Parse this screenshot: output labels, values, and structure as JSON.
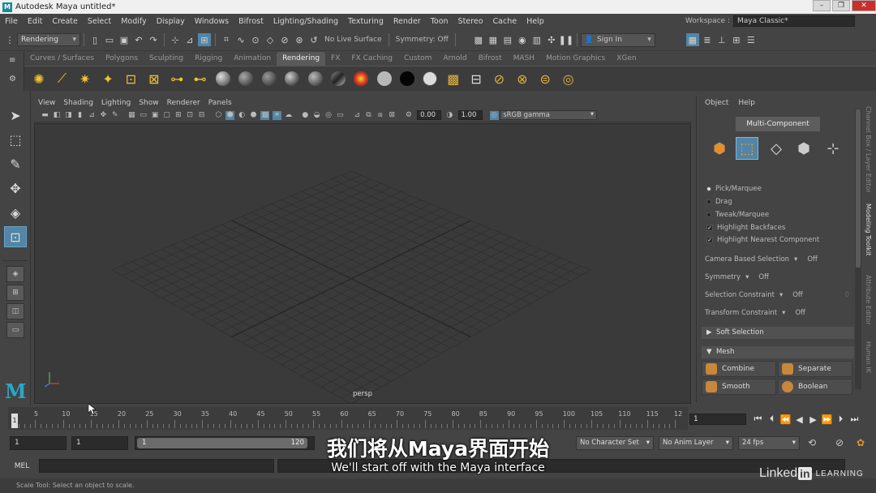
{
  "window": {
    "title": "Autodesk Maya  untitled*",
    "logo_letter": "M",
    "controls": {
      "minimize": "–",
      "restore": "❐",
      "close": "✕"
    }
  },
  "menubar": {
    "items": [
      "File",
      "Edit",
      "Create",
      "Select",
      "Modify",
      "Display",
      "Windows",
      "Bifrost",
      "Lighting/Shading",
      "Texturing",
      "Render",
      "Toon",
      "Stereo",
      "Cache",
      "Help"
    ],
    "workspace_label": "Workspace :",
    "workspace_value": "Maya Classic*"
  },
  "statusline": {
    "menuset": "Rendering",
    "live_surface": "No Live Surface",
    "symmetry": "Symmetry: Off",
    "sign_in": "Sign In"
  },
  "shelf": {
    "tabs": [
      "Curves / Surfaces",
      "Polygons",
      "Sculpting",
      "Rigging",
      "Animation",
      "Rendering",
      "FX",
      "FX Caching",
      "Custom",
      "Arnold",
      "Bifrost",
      "MASH",
      "Motion Graphics",
      "XGen"
    ],
    "active_tab": "Rendering"
  },
  "viewport": {
    "menu": [
      "View",
      "Shading",
      "Lighting",
      "Show",
      "Renderer",
      "Panels"
    ],
    "exposure": "0.00",
    "gamma_value": "1.00",
    "color_space": "sRGB gamma",
    "camera_label": "persp"
  },
  "modeling_toolkit": {
    "menu": [
      "Object",
      "Help"
    ],
    "multi_component": "Multi-Component",
    "selection_modes": {
      "pick": "Pick/Marquee",
      "drag": "Drag",
      "tweak": "Tweak/Marquee"
    },
    "checks": {
      "backfaces": "Highlight Backfaces",
      "nearest": "Highlight Nearest Component"
    },
    "settings": {
      "camera_based": {
        "label": "Camera Based Selection",
        "value": "Off"
      },
      "symmetry": {
        "label": "Symmetry",
        "value": "Off"
      },
      "sel_constraint": {
        "label": "Selection Constraint",
        "value": "Off",
        "extra": "0"
      },
      "transform_constraint": {
        "label": "Transform Constraint",
        "value": "Off"
      }
    },
    "sections": {
      "soft": "Soft Selection",
      "mesh": "Mesh"
    },
    "mesh_buttons": {
      "combine": "Combine",
      "separate": "Separate",
      "smooth": "Smooth",
      "boolean": "Boolean"
    }
  },
  "side_tabs": [
    "Channel Box / Layer Editor",
    "Modeling Toolkit",
    "Attribute Editor",
    "Human IK"
  ],
  "timeslider": {
    "ticks": [
      "5",
      "10",
      "15",
      "20",
      "25",
      "30",
      "35",
      "40",
      "45",
      "50",
      "55",
      "60",
      "65",
      "70",
      "75",
      "80",
      "85",
      "90",
      "95",
      "100",
      "105",
      "110",
      "115",
      "12"
    ],
    "current_frame": "1",
    "current_field": "1"
  },
  "rangebar": {
    "start": "1",
    "playback_start": "1",
    "range_start": "1",
    "range_end": "120",
    "character_set": "No Character Set",
    "anim_layer": "No Anim Layer",
    "fps": "24 fps"
  },
  "cmdline": {
    "mode": "MEL"
  },
  "helpline": "Scale Tool: Select an object to scale.",
  "subtitles": {
    "zh": "我们将从Maya界面开始",
    "en": "We'll start off with the Maya interface"
  },
  "watermark": {
    "linked": "Linked",
    "in": "in",
    "learning": "LEARNING"
  }
}
